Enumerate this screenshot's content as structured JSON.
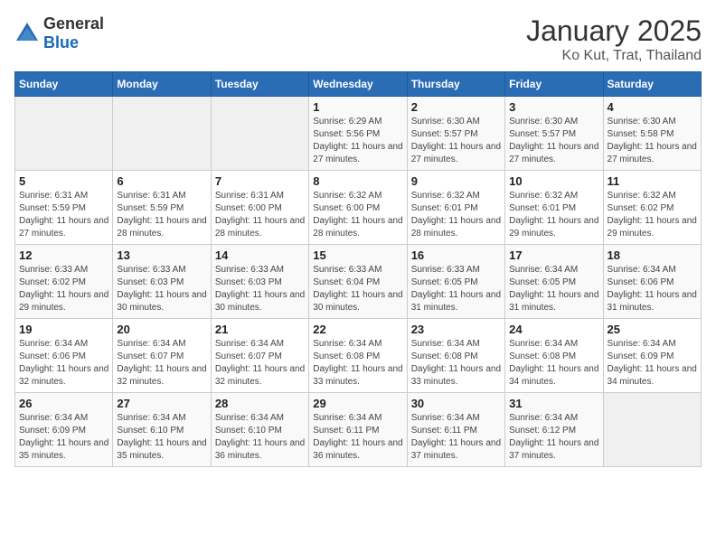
{
  "logo": {
    "general": "General",
    "blue": "Blue"
  },
  "title": "January 2025",
  "subtitle": "Ko Kut, Trat, Thailand",
  "days_of_week": [
    "Sunday",
    "Monday",
    "Tuesday",
    "Wednesday",
    "Thursday",
    "Friday",
    "Saturday"
  ],
  "weeks": [
    [
      {
        "day": "",
        "info": ""
      },
      {
        "day": "",
        "info": ""
      },
      {
        "day": "",
        "info": ""
      },
      {
        "day": "1",
        "info": "Sunrise: 6:29 AM\nSunset: 5:56 PM\nDaylight: 11 hours and 27 minutes."
      },
      {
        "day": "2",
        "info": "Sunrise: 6:30 AM\nSunset: 5:57 PM\nDaylight: 11 hours and 27 minutes."
      },
      {
        "day": "3",
        "info": "Sunrise: 6:30 AM\nSunset: 5:57 PM\nDaylight: 11 hours and 27 minutes."
      },
      {
        "day": "4",
        "info": "Sunrise: 6:30 AM\nSunset: 5:58 PM\nDaylight: 11 hours and 27 minutes."
      }
    ],
    [
      {
        "day": "5",
        "info": "Sunrise: 6:31 AM\nSunset: 5:59 PM\nDaylight: 11 hours and 27 minutes."
      },
      {
        "day": "6",
        "info": "Sunrise: 6:31 AM\nSunset: 5:59 PM\nDaylight: 11 hours and 28 minutes."
      },
      {
        "day": "7",
        "info": "Sunrise: 6:31 AM\nSunset: 6:00 PM\nDaylight: 11 hours and 28 minutes."
      },
      {
        "day": "8",
        "info": "Sunrise: 6:32 AM\nSunset: 6:00 PM\nDaylight: 11 hours and 28 minutes."
      },
      {
        "day": "9",
        "info": "Sunrise: 6:32 AM\nSunset: 6:01 PM\nDaylight: 11 hours and 28 minutes."
      },
      {
        "day": "10",
        "info": "Sunrise: 6:32 AM\nSunset: 6:01 PM\nDaylight: 11 hours and 29 minutes."
      },
      {
        "day": "11",
        "info": "Sunrise: 6:32 AM\nSunset: 6:02 PM\nDaylight: 11 hours and 29 minutes."
      }
    ],
    [
      {
        "day": "12",
        "info": "Sunrise: 6:33 AM\nSunset: 6:02 PM\nDaylight: 11 hours and 29 minutes."
      },
      {
        "day": "13",
        "info": "Sunrise: 6:33 AM\nSunset: 6:03 PM\nDaylight: 11 hours and 30 minutes."
      },
      {
        "day": "14",
        "info": "Sunrise: 6:33 AM\nSunset: 6:03 PM\nDaylight: 11 hours and 30 minutes."
      },
      {
        "day": "15",
        "info": "Sunrise: 6:33 AM\nSunset: 6:04 PM\nDaylight: 11 hours and 30 minutes."
      },
      {
        "day": "16",
        "info": "Sunrise: 6:33 AM\nSunset: 6:05 PM\nDaylight: 11 hours and 31 minutes."
      },
      {
        "day": "17",
        "info": "Sunrise: 6:34 AM\nSunset: 6:05 PM\nDaylight: 11 hours and 31 minutes."
      },
      {
        "day": "18",
        "info": "Sunrise: 6:34 AM\nSunset: 6:06 PM\nDaylight: 11 hours and 31 minutes."
      }
    ],
    [
      {
        "day": "19",
        "info": "Sunrise: 6:34 AM\nSunset: 6:06 PM\nDaylight: 11 hours and 32 minutes."
      },
      {
        "day": "20",
        "info": "Sunrise: 6:34 AM\nSunset: 6:07 PM\nDaylight: 11 hours and 32 minutes."
      },
      {
        "day": "21",
        "info": "Sunrise: 6:34 AM\nSunset: 6:07 PM\nDaylight: 11 hours and 32 minutes."
      },
      {
        "day": "22",
        "info": "Sunrise: 6:34 AM\nSunset: 6:08 PM\nDaylight: 11 hours and 33 minutes."
      },
      {
        "day": "23",
        "info": "Sunrise: 6:34 AM\nSunset: 6:08 PM\nDaylight: 11 hours and 33 minutes."
      },
      {
        "day": "24",
        "info": "Sunrise: 6:34 AM\nSunset: 6:08 PM\nDaylight: 11 hours and 34 minutes."
      },
      {
        "day": "25",
        "info": "Sunrise: 6:34 AM\nSunset: 6:09 PM\nDaylight: 11 hours and 34 minutes."
      }
    ],
    [
      {
        "day": "26",
        "info": "Sunrise: 6:34 AM\nSunset: 6:09 PM\nDaylight: 11 hours and 35 minutes."
      },
      {
        "day": "27",
        "info": "Sunrise: 6:34 AM\nSunset: 6:10 PM\nDaylight: 11 hours and 35 minutes."
      },
      {
        "day": "28",
        "info": "Sunrise: 6:34 AM\nSunset: 6:10 PM\nDaylight: 11 hours and 36 minutes."
      },
      {
        "day": "29",
        "info": "Sunrise: 6:34 AM\nSunset: 6:11 PM\nDaylight: 11 hours and 36 minutes."
      },
      {
        "day": "30",
        "info": "Sunrise: 6:34 AM\nSunset: 6:11 PM\nDaylight: 11 hours and 37 minutes."
      },
      {
        "day": "31",
        "info": "Sunrise: 6:34 AM\nSunset: 6:12 PM\nDaylight: 11 hours and 37 minutes."
      },
      {
        "day": "",
        "info": ""
      }
    ]
  ]
}
